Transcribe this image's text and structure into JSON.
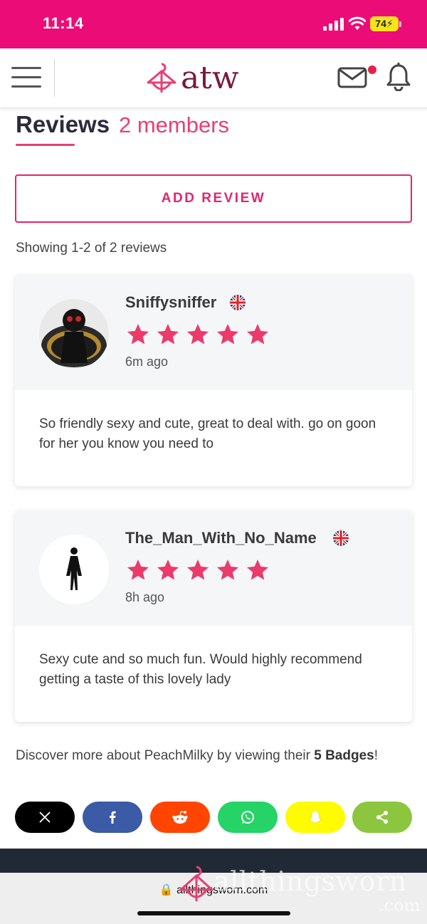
{
  "status": {
    "time": "11:14",
    "battery": "74"
  },
  "navbar": {
    "logo_text": "atw",
    "icons": [
      "menu-icon",
      "mail-icon",
      "bell-icon"
    ],
    "has_notification_dot": true
  },
  "page": {
    "title": "Reviews",
    "count_label": "2 members",
    "add_review_label": "ADD REVIEW",
    "showing_text": "Showing 1-2 of 2 reviews"
  },
  "reviews": [
    {
      "username": "Sniffysniffer",
      "country_flag": "uk-flag-icon",
      "rating": 5,
      "time": "6m ago",
      "text": "So friendly sexy and cute, great to deal with. go on goon for her you know you need to"
    },
    {
      "username": "The_Man_With_No_Name",
      "country_flag": "uk-flag-icon",
      "rating": 5,
      "time": "8h ago",
      "text": "Sexy cute and so much fun. Would highly recommend getting a taste of this lovely lady"
    }
  ],
  "discover": {
    "prefix": "Discover more about PeachMilky by viewing their ",
    "badges": "5 Badges",
    "suffix": "!"
  },
  "share_buttons": [
    {
      "name": "x-share-button",
      "icon": "x-icon",
      "color": "#000000"
    },
    {
      "name": "facebook-share-button",
      "icon": "facebook-icon",
      "color": "#3b5ba6"
    },
    {
      "name": "reddit-share-button",
      "icon": "reddit-icon",
      "color": "#ff4500"
    },
    {
      "name": "whatsapp-share-button",
      "icon": "whatsapp-icon",
      "color": "#25d366"
    },
    {
      "name": "snapchat-share-button",
      "icon": "snapchat-icon",
      "color": "#fffc00"
    },
    {
      "name": "generic-share-button",
      "icon": "share-icon",
      "color": "#8cc63f"
    }
  ],
  "browser": {
    "url": "allthingsworn.com"
  },
  "watermark": {
    "text": "allthingsworn",
    "suffix": ".com"
  },
  "colors": {
    "brand_pink": "#ec0c77",
    "accent": "#e83f73",
    "star": "#ec3a6b",
    "footer": "#1f2a36"
  }
}
